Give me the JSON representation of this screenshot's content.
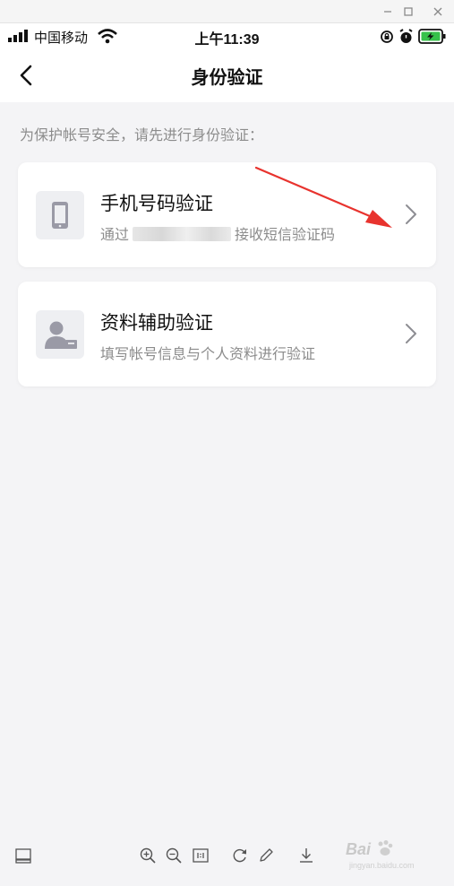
{
  "status_bar": {
    "carrier": "中国移动",
    "time": "上午11:39"
  },
  "nav": {
    "title": "身份验证"
  },
  "hint": "为保护帐号安全，请先进行身份验证：",
  "options": [
    {
      "title": "手机号码验证",
      "sub_prefix": "通过",
      "sub_suffix": "接收短信验证码",
      "icon": "phone-icon"
    },
    {
      "title": "资料辅助验证",
      "sub": "填写帐号信息与个人资料进行验证",
      "icon": "profile-card-icon"
    }
  ],
  "watermark": {
    "brand": "Bai",
    "sub": "jingyan.baidu.com"
  },
  "colors": {
    "accent_arrow": "#e8332e",
    "icon_gray": "#9a9aa6",
    "page_bg": "#f4f4f6"
  }
}
